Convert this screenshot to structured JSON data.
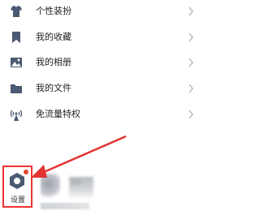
{
  "menu": {
    "items": [
      {
        "label": "个性装扮",
        "icon": "shirt-icon"
      },
      {
        "label": "我的收藏",
        "icon": "bookmark-icon"
      },
      {
        "label": "我的相册",
        "icon": "image-icon"
      },
      {
        "label": "我的文件",
        "icon": "folder-icon"
      },
      {
        "label": "免流量特权",
        "icon": "signal-tower-icon"
      }
    ]
  },
  "bottom": {
    "settings_label": "设置",
    "blurred_label": "3G"
  },
  "colors": {
    "icon_dark": "#4a5a72",
    "chevron": "#b0b4ba",
    "highlight": "#e33333",
    "badge": "#e3462b",
    "arrow": "#e33333"
  }
}
